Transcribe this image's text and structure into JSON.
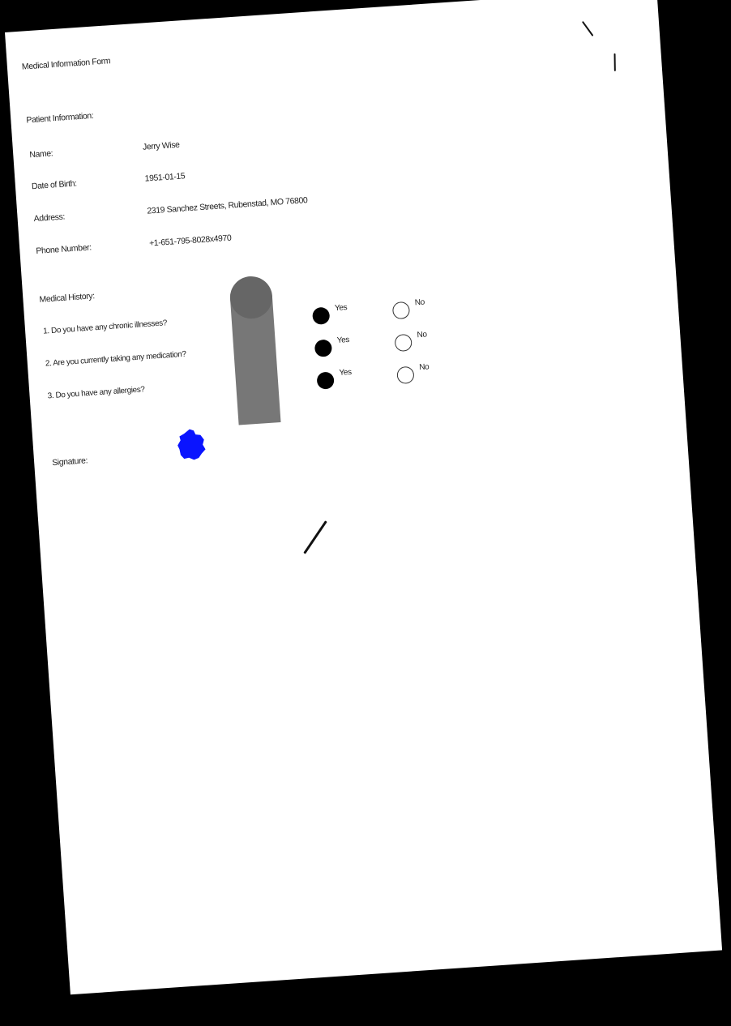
{
  "form": {
    "title": "Medical Information Form",
    "patient_section_heading": "Patient Information:",
    "fields": [
      {
        "label": "Name:",
        "value": "Jerry Wise"
      },
      {
        "label": "Date of Birth:",
        "value": "1951-01-15"
      },
      {
        "label": "Address:",
        "value": "2319 Sanchez Streets, Rubenstad, MO 76800"
      },
      {
        "label": "Phone Number:",
        "value": "+1-651-795-8028x4970"
      }
    ],
    "history_heading": "Medical History:",
    "questions": [
      {
        "text": "1. Do you have any chronic illnesses?",
        "yes_label": "Yes",
        "no_label": "No",
        "selected": "Yes"
      },
      {
        "text": "2. Are you currently taking any medication?",
        "yes_label": "Yes",
        "no_label": "No",
        "selected": "Yes"
      },
      {
        "text": "3. Do you have any allergies?",
        "yes_label": "Yes",
        "no_label": "No",
        "selected": "Yes"
      }
    ],
    "signature_label": "Signature:"
  },
  "colors": {
    "page": "#ffffff",
    "background": "#000000",
    "ink": "#222222",
    "signature_ink": "#0a14ff",
    "marker_gray": "#777777"
  }
}
